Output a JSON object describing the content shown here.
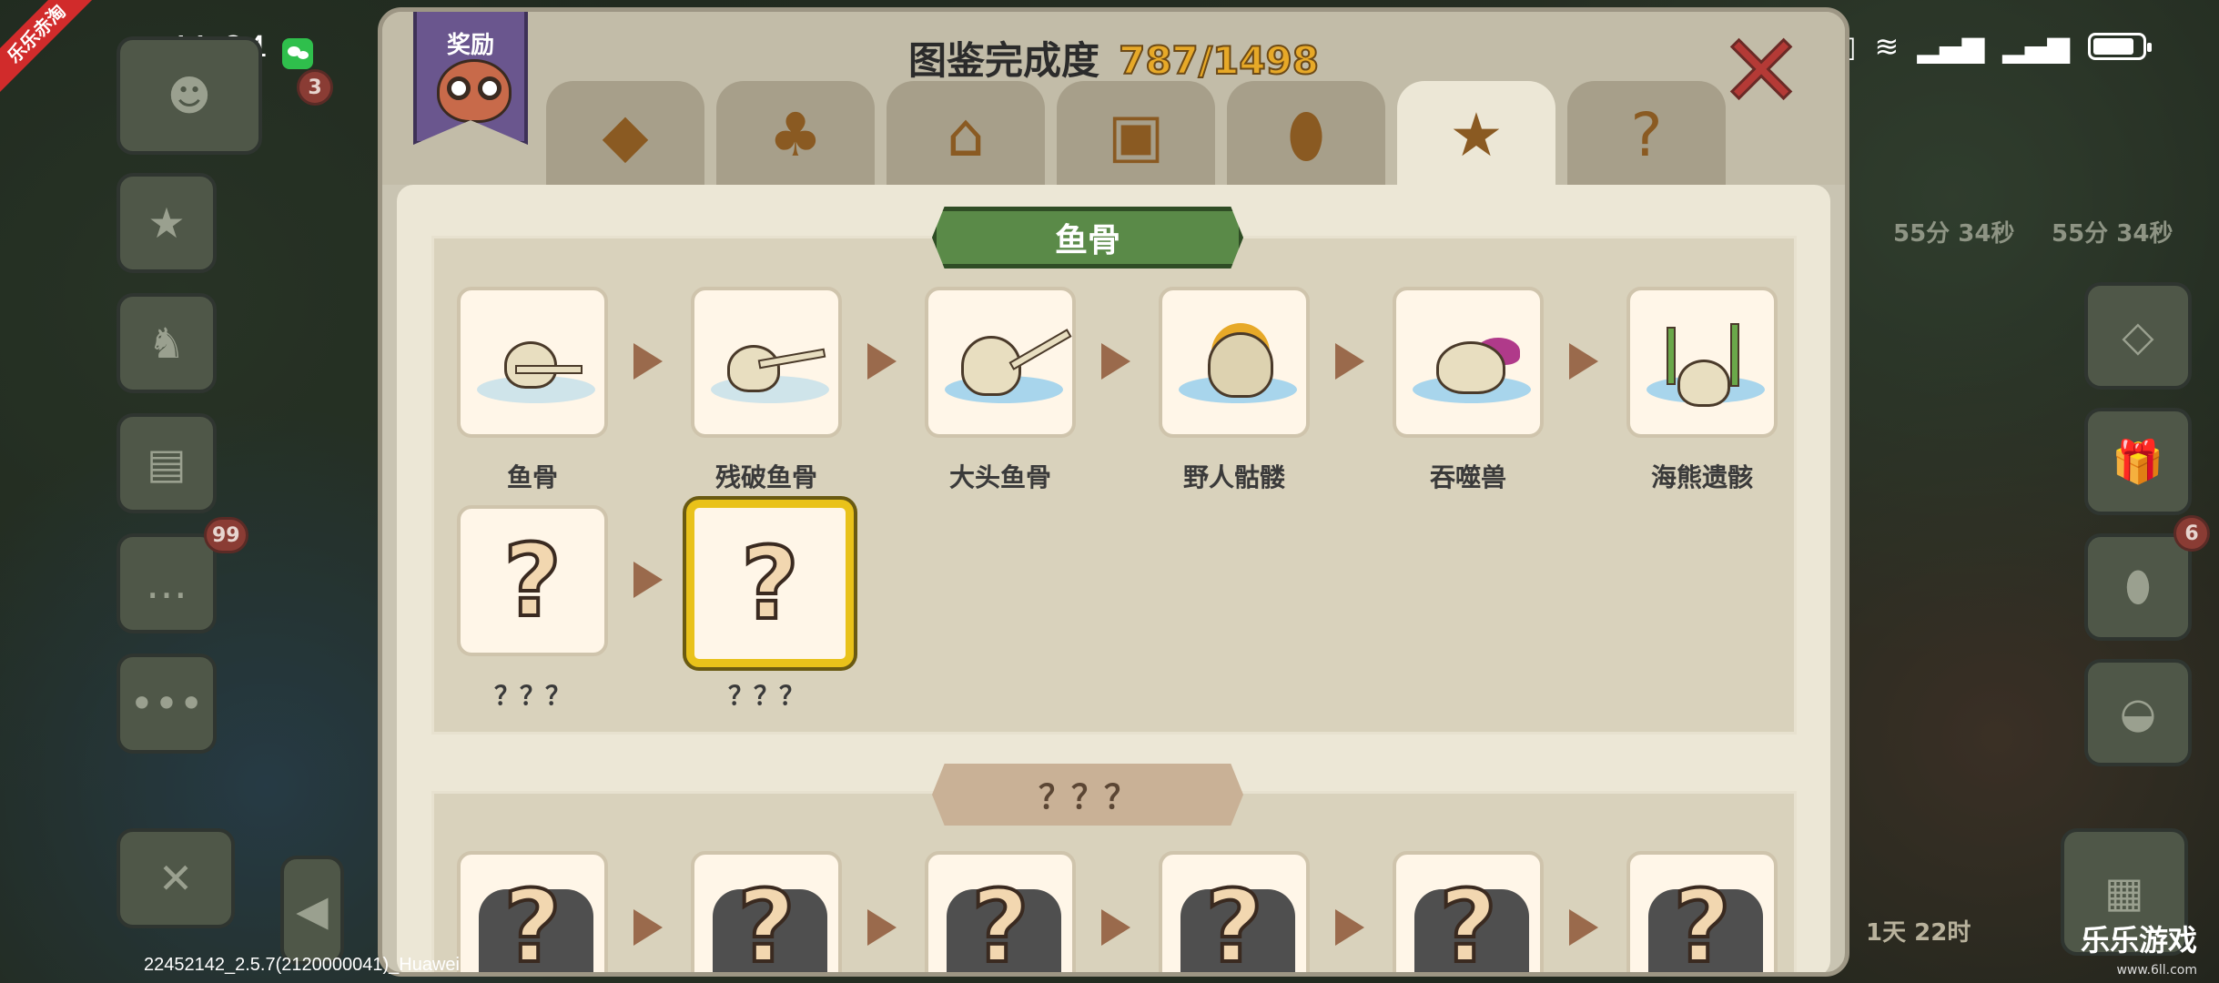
{
  "status_bar": {
    "time": "11:04",
    "ribbon": "乐乐赤淘"
  },
  "left_badges": {
    "chat_count": "99",
    "level": "3"
  },
  "right_badges": {
    "egg_count": "6"
  },
  "timers": [
    "55分 34秒",
    "55分 34秒"
  ],
  "right_timer": "1天 22时",
  "dialog": {
    "reward_label": "奖励",
    "title_label": "图鉴完成度",
    "title_value": "787/1498",
    "close_icon": "close-x",
    "tabs": [
      {
        "name": "diamond-icon",
        "glyph": "◆",
        "active": false
      },
      {
        "name": "clover-icon",
        "glyph": "♣",
        "active": false
      },
      {
        "name": "house-icon",
        "glyph": "⌂",
        "active": false
      },
      {
        "name": "chest-icon",
        "glyph": "▣",
        "active": false
      },
      {
        "name": "egg-icon",
        "glyph": "⬮",
        "active": false
      },
      {
        "name": "star-icon",
        "glyph": "★",
        "active": true
      },
      {
        "name": "question-icon",
        "glyph": "?",
        "active": false
      }
    ],
    "section1": {
      "title": "鱼骨",
      "items": [
        "鱼骨",
        "残破鱼骨",
        "大头鱼骨",
        "野人骷髅",
        "吞噬兽",
        "海熊遗骸",
        "？？？",
        "？？？"
      ]
    },
    "section2": {
      "title": "？？？"
    }
  },
  "footer": {
    "build": "22452142_2.5.7(2120000041)_Huawei",
    "watermark": "乐乐游戏",
    "watermark_sub": "www.6ll.com"
  }
}
